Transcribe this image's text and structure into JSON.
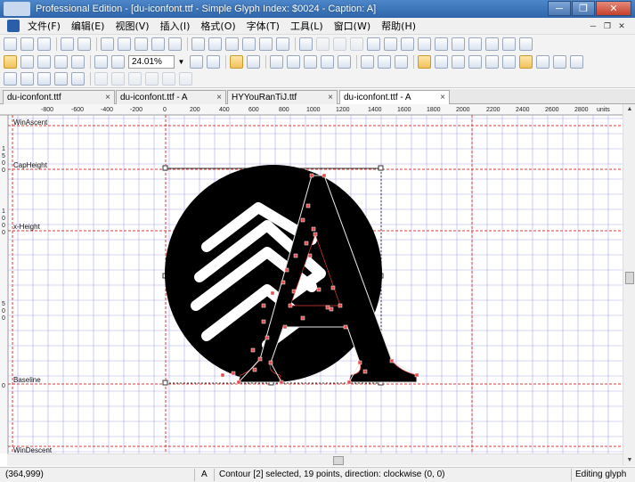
{
  "window": {
    "title": "Professional Edition - [du-iconfont.ttf - Simple Glyph Index: $0024 - Caption: A]",
    "minimize_glyph": "─",
    "restore_glyph": "❐",
    "close_glyph": "✕"
  },
  "menu": {
    "items": [
      "文件(F)",
      "编辑(E)",
      "视图(V)",
      "插入(I)",
      "格式(O)",
      "字体(T)",
      "工具(L)",
      "窗口(W)",
      "帮助(H)"
    ],
    "window_controls": [
      "─",
      "❐",
      "✕"
    ]
  },
  "toolbar": {
    "zoom_value": "24.01%",
    "zoom_dropdown_glyph": "▼"
  },
  "tabs": [
    {
      "label": "du-iconfont.ttf",
      "active": false
    },
    {
      "label": "du-iconfont.ttf - A",
      "active": false
    },
    {
      "label": "HYYouRanTiJ.ttf",
      "active": false
    },
    {
      "label": "du-iconfont.ttf - A",
      "active": true
    }
  ],
  "tab_close_glyph": "×",
  "ruler": {
    "units_label": "units",
    "h_ticks": [
      "-800",
      "-600",
      "-400",
      "-200",
      "0",
      "200",
      "400",
      "600",
      "800",
      "1000",
      "1200",
      "1400",
      "1600",
      "1800",
      "2000",
      "2200",
      "2400",
      "2600",
      "2800"
    ]
  },
  "guides": {
    "win_ascent": "WinAscent",
    "cap_height": "CapHeight",
    "x_height": "x-Height",
    "baseline": "Baseline",
    "win_descent": "WinDescent"
  },
  "vertical_ruler_digits": {
    "cap_height": [
      "1",
      "5",
      "0",
      "0"
    ],
    "x_height": [
      "1",
      "0",
      "0",
      "0"
    ],
    "mid": [
      "5",
      "0",
      "0"
    ],
    "baseline": [
      "0"
    ]
  },
  "colors": {
    "grid_blue": "#a9a9e8",
    "guide_red": "#e23a3a",
    "glyph_fill": "#000000",
    "point_marker": "#e24a4a",
    "title_blue": "#3a72b8"
  },
  "status": {
    "coordinates": "(364,999)",
    "glyph": "A",
    "message": "Contour [2] selected, 19 points, direction: clockwise (0, 0)",
    "mode": "Editing glyph"
  }
}
